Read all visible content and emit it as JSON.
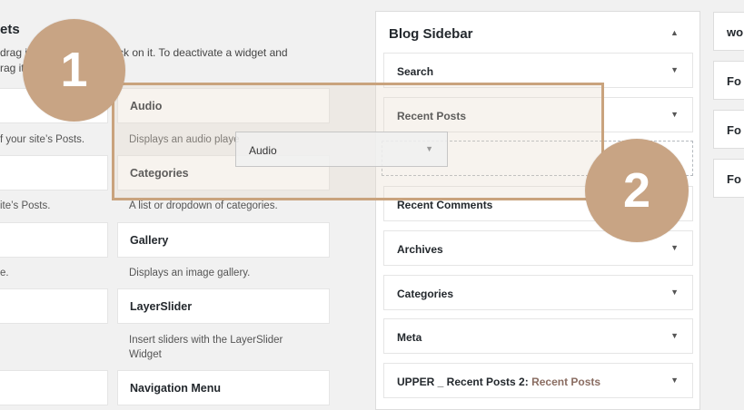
{
  "page": {
    "title": "ets",
    "intro_line1": "drag i",
    "intro_line1b": "ck on it. To deactivate a widget and",
    "intro_line2": "rag it"
  },
  "left_column": {
    "descs": [
      "f your site’s Posts.",
      "ite’s Posts.",
      "e."
    ]
  },
  "available_widgets": [
    {
      "name": "Audio",
      "desc": "Displays an audio playe"
    },
    {
      "name": "Categories",
      "desc": "A list or dropdown of categories."
    },
    {
      "name": "Gallery",
      "desc": "Displays an image gallery."
    },
    {
      "name": "LayerSlider",
      "desc": "Insert sliders with the LayerSlider",
      "desc2": "Widget"
    },
    {
      "name": "Navigation Menu"
    }
  ],
  "dragging_widget": {
    "name": "Audio"
  },
  "sidebar": {
    "title": "Blog Sidebar",
    "items": [
      {
        "label": "Search"
      },
      {
        "label": "Recent Posts"
      },
      {
        "label": "Recent Comments"
      },
      {
        "label": "Archives"
      },
      {
        "label": "Categories"
      },
      {
        "label": "Meta"
      },
      {
        "label": "UPPER _ Recent Posts 2:",
        "sub": "Recent Posts"
      }
    ]
  },
  "right_column": [
    "wo",
    "Fo",
    "Fo",
    "Fo"
  ],
  "callouts": {
    "one": "1",
    "two": "2"
  },
  "colors": {
    "callout": "#c8a484",
    "highlight_border": "#c9a37d"
  },
  "icons": {
    "toggle": "triangle-up-icon",
    "expand": "triangle-down-icon"
  }
}
